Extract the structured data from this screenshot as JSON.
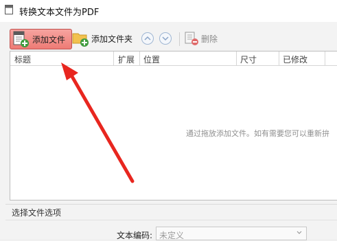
{
  "window": {
    "title": "转换文本文件为PDF"
  },
  "toolbar": {
    "add_file_label": "添加文件",
    "add_folder_label": "添加文件夹",
    "delete_label": "删除"
  },
  "list": {
    "columns": [
      "标题",
      "扩展",
      "位置",
      "尺寸",
      "已修改"
    ],
    "empty_hint": "通过拖放添加文件。如有需要您可以重新拚"
  },
  "options": {
    "section_title": "选择文件选项",
    "encoding_label": "文本编码:",
    "encoding_value": "未定义"
  },
  "colors": {
    "add_file_highlight": "#ee7b75",
    "annotation_arrow": "#e8261f"
  }
}
